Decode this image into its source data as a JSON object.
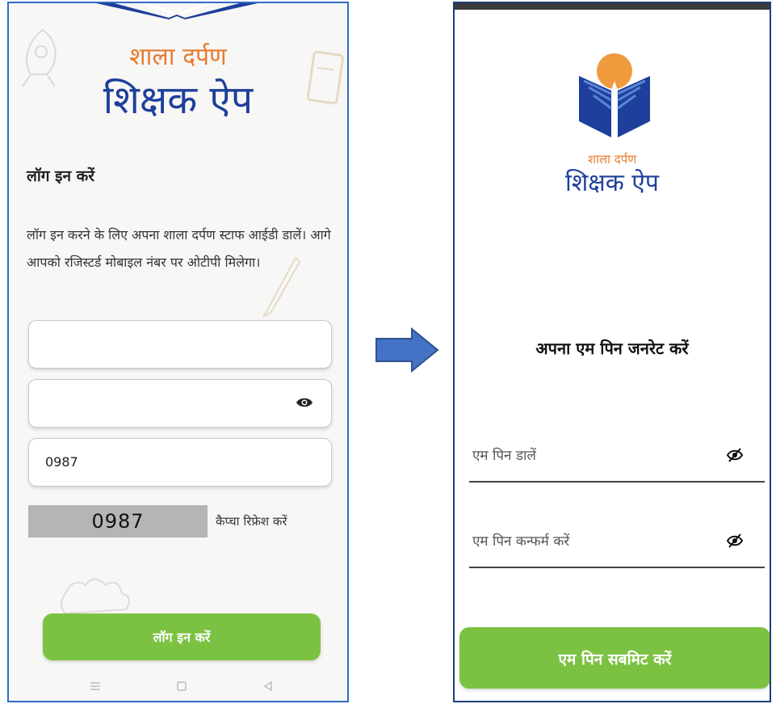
{
  "login_screen": {
    "logo_shala": "शाला दर्पण",
    "logo_app": "शिक्षक ऐप",
    "heading": "लॉग इन करें",
    "description": "लॉग इन करने के लिए अपना शाला दर्पण स्टाफ आईडी डालें। आगे आपको रजिस्टर्ड मोबाइल नंबर पर ओटीपी मिलेगा।",
    "staff_id_value": "",
    "password_value": "",
    "captcha_input_value": "0987",
    "captcha_code": "0987",
    "captcha_refresh": "कैप्चा रिफ्रेश करें",
    "login_button": "लॉग इन करें"
  },
  "mpin_screen": {
    "logo_shala": "शाला दर्पण",
    "logo_app": "शिक्षक ऐप",
    "title": "अपना एम पिन जनरेट करें",
    "mpin_placeholder": "एम पिन डालें",
    "confirm_placeholder": "एम पिन कन्फर्म करें",
    "submit_button": "एम पिन सबमिट करें"
  },
  "colors": {
    "accent_green": "#7cc242",
    "brand_blue": "#1e3f9b",
    "brand_orange": "#e77a2f",
    "arrow_blue": "#4472c4"
  },
  "icons": [
    "eye-icon",
    "eye-off-icon",
    "menu-nav-icon",
    "home-nav-icon",
    "back-nav-icon",
    "right-arrow-icon",
    "book-logo-icon"
  ]
}
